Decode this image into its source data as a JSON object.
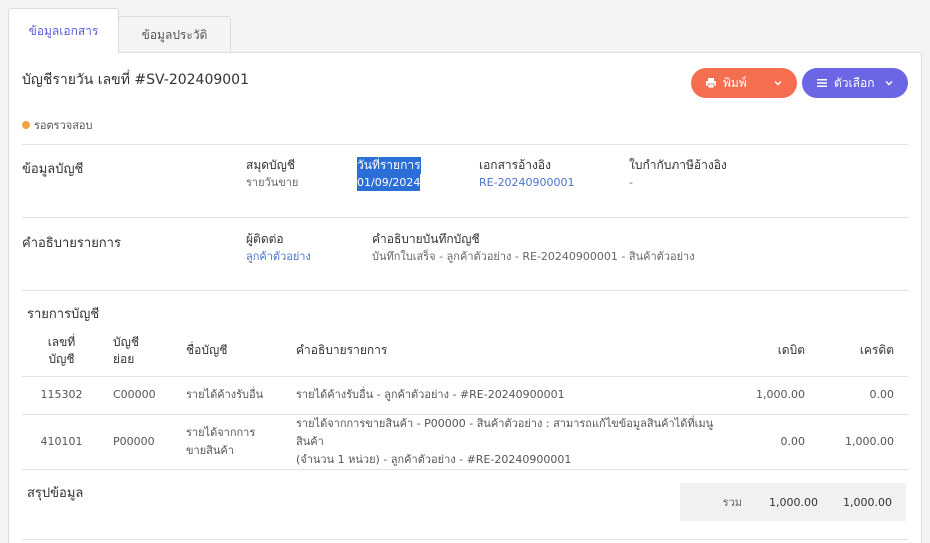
{
  "tabs": [
    {
      "label": "ข้อมูลเอกสาร"
    },
    {
      "label": "ข้อมูลประวัติ"
    }
  ],
  "header": {
    "title": "บัญชีรายวัน เลขที่ #SV-202409001",
    "status": "รอตรวจสอบ",
    "print_label": "พิมพ์",
    "options_label": "ตัวเลือก"
  },
  "colors": {
    "print_button": "#f46e4f",
    "options_button": "#6b66e3",
    "status_dot": "#f5a23a",
    "link": "#4a74c9"
  },
  "account_info": {
    "section_label": "ข้อมูลบัญชี",
    "journal_label": "สมุดบัญชี",
    "journal_value": "รายวันขาย",
    "date_label": "วันที่รายการ",
    "date_value": "01/09/2024",
    "ref_doc_label": "เอกสารอ้างอิง",
    "ref_doc_value": "RE-20240900001",
    "tax_ref_label": "ใบกำกับภาษีอ้างอิง",
    "tax_ref_value": "-"
  },
  "description": {
    "section_label": "คำอธิบายรายการ",
    "contact_label": "ผู้ติดต่อ",
    "contact_value": "ลูกค้าตัวอย่าง",
    "memo_label": "คำอธิบายบันทึกบัญชี",
    "memo_value": "บันทึกใบเสร็จ - ลูกค้าตัวอย่าง - RE-20240900001 - สินค้าตัวอย่าง"
  },
  "entries": {
    "section_label": "รายการบัญชี",
    "headers": {
      "account_no": "เลขที่\nบัญชี",
      "sub_account": "บัญชี\nย่อย",
      "account_name": "ชื่อบัญชี",
      "description": "คำอธิบายรายการ",
      "debit": "เดบิต",
      "credit": "เครดิต"
    },
    "rows": [
      {
        "account_no": "115302",
        "sub_account": "C00000",
        "account_name": "รายได้ค้างรับอื่น",
        "description": "รายได้ค้างรับอื่น - ลูกค้าตัวอย่าง - #RE-20240900001",
        "debit": "1,000.00",
        "credit": "0.00"
      },
      {
        "account_no": "410101",
        "sub_account": "P00000",
        "account_name": "รายได้จากการ\nขายสินค้า",
        "description": "รายได้จากการขายสินค้า - P00000 - สินค้าตัวอย่าง : สามารถแก้ไขข้อมูลสินค้าได้ที่เมนูสินค้า\n(จำนวน 1 หน่วย) - ลูกค้าตัวอย่าง - #RE-20240900001",
        "debit": "0.00",
        "credit": "1,000.00"
      }
    ]
  },
  "summary": {
    "section_label": "สรุปข้อมูล",
    "total_label": "รวม",
    "total_debit": "1,000.00",
    "total_credit": "1,000.00"
  }
}
